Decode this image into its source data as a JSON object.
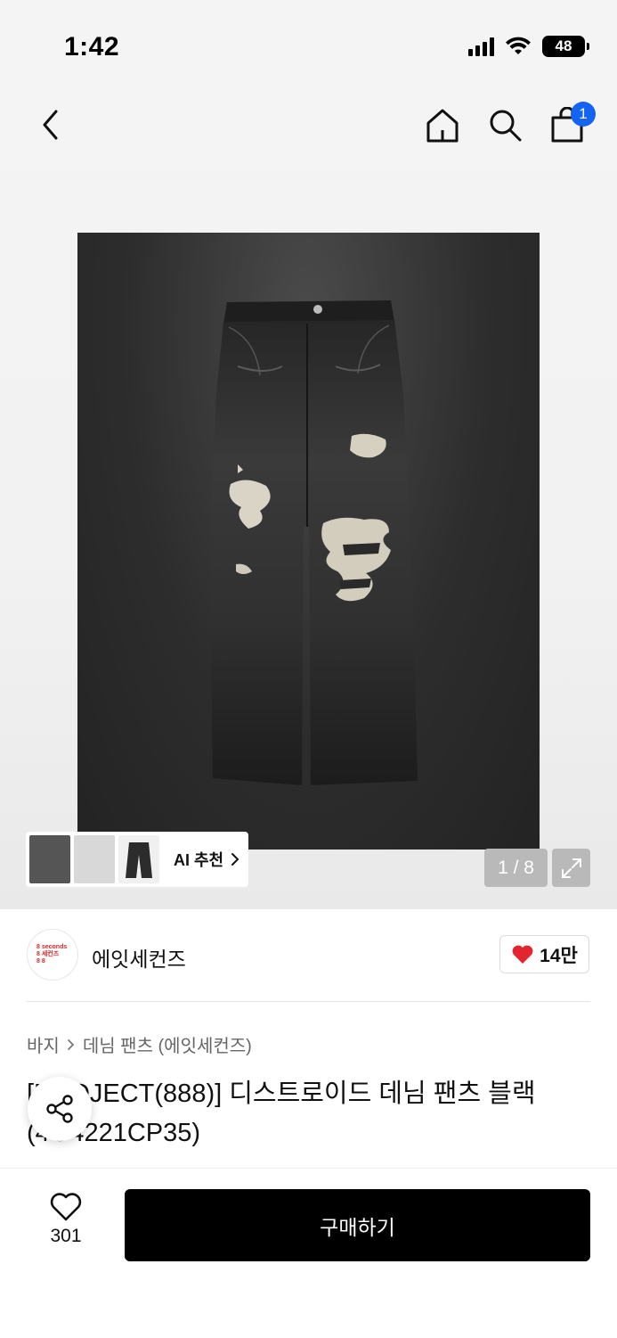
{
  "status": {
    "time": "1:42",
    "battery": "48"
  },
  "nav": {
    "cart_count": "1"
  },
  "gallery": {
    "ai_label": "AI 추천",
    "pager": "1 / 8"
  },
  "brand": {
    "name": "에잇세컨즈",
    "logo_lines": [
      "8 seconds",
      "8 세컨즈",
      "8 8"
    ],
    "likes": "14만"
  },
  "breadcrumb": {
    "category": "바지",
    "subcategory": "데님 팬츠 (에잇세컨즈)"
  },
  "product": {
    "title": "[PROJECT(888)] 디스트로이드 데님 팬츠 블랙 (4O4221CP35)"
  },
  "bottom": {
    "wish_count": "301",
    "buy_label": "구매하기"
  },
  "colors": {
    "accent_blue": "#1463f3",
    "heart_red": "#e3262d",
    "buy_bg": "#000000"
  }
}
